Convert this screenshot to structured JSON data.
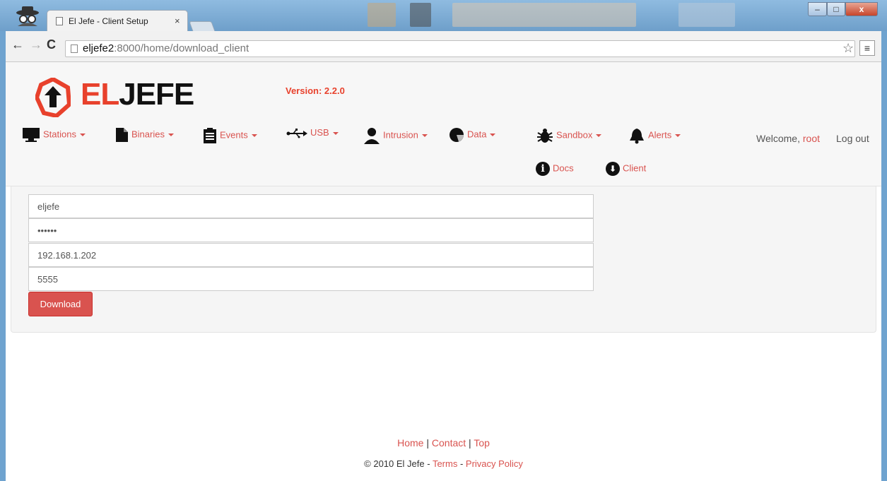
{
  "browser": {
    "tab_title": "El Jefe - Client Setup",
    "tab_close": "×",
    "url_host": "eljefe2",
    "url_path": ":8000/home/download_client",
    "minimize_label": "–",
    "maximize_label": "□",
    "close_label": "x"
  },
  "header": {
    "logo_el": "EL",
    "logo_jefe": "JEFE",
    "version": "Version: 2.2.0"
  },
  "nav": {
    "items": [
      {
        "label": "Stations",
        "icon": "monitor-icon"
      },
      {
        "label": "Binaries",
        "icon": "file-icon"
      },
      {
        "label": "Events",
        "icon": "clipboard-icon"
      },
      {
        "label": "USB",
        "icon": "usb-icon"
      },
      {
        "label": "Intrusion",
        "icon": "intruder-icon"
      },
      {
        "label": "Data",
        "icon": "pie-chart-icon"
      },
      {
        "label": "Sandbox",
        "icon": "bug-icon"
      },
      {
        "label": "Alerts",
        "icon": "bell-icon"
      }
    ],
    "welcome_prefix": "Welcome,",
    "user": "root",
    "logout": "Log out",
    "docs": "Docs",
    "client": "Client"
  },
  "form": {
    "username": "eljefe",
    "password": "••••••",
    "host": "192.168.1.202",
    "port": "5555",
    "download_label": "Download"
  },
  "footer": {
    "home": "Home",
    "contact": "Contact",
    "top": "Top",
    "sep": "|",
    "copyright": "© 2010 El Jefe - ",
    "terms": "Terms",
    "dash": " - ",
    "privacy": "Privacy Policy"
  },
  "colors": {
    "accent": "#d9534f",
    "logo_red": "#e8412c"
  }
}
